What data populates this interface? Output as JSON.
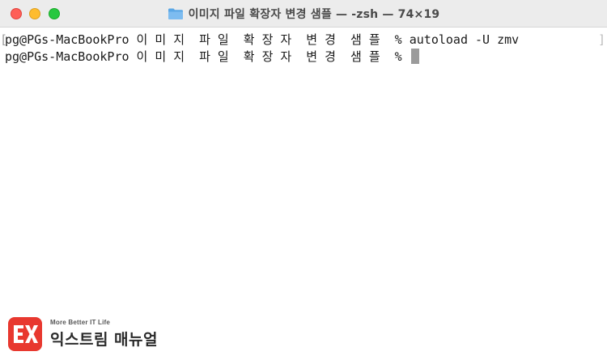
{
  "window": {
    "title": "이미지 파일 확장자 변경 샘플 — -zsh — 74×19",
    "folder_icon": "folder-icon",
    "controls": {
      "close_color": "#fe5f57",
      "minimize_color": "#febc2e",
      "zoom_color": "#28c840"
    }
  },
  "terminal": {
    "lines": [
      "pg@PGs-MacBookPro 이 미 지  파 일  확 장 자  변 경  샘 플  % autoload -U zmv",
      "pg@PGs-MacBookPro 이 미 지  파 일  확 장 자  변 경  샘 플  % "
    ],
    "bracket_left": "[",
    "bracket_right": "]"
  },
  "watermark": {
    "tagline": "More Better IT Life",
    "name": "익스트림 매뉴얼",
    "logo_icon": "ex-logo-icon",
    "brand_color": "#e8382f"
  }
}
